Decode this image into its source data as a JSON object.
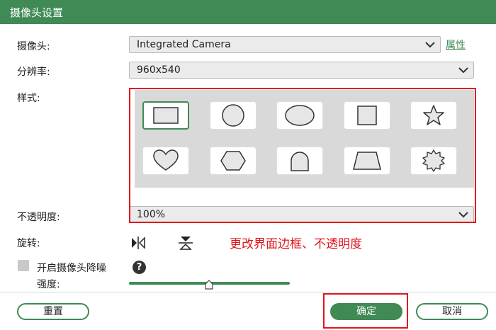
{
  "window": {
    "title": "摄像头设置"
  },
  "camera": {
    "label": "摄像头:",
    "value": "Integrated Camera",
    "properties_link": "属性"
  },
  "resolution": {
    "label": "分辨率:",
    "value": "960x540"
  },
  "style": {
    "label": "样式:",
    "shapes": [
      "rectangle",
      "circle",
      "ellipse",
      "square",
      "star",
      "heart",
      "hexagon",
      "arch",
      "trapezoid",
      "badge"
    ],
    "selected": "rectangle"
  },
  "opacity": {
    "label": "不透明度:",
    "value": "100%"
  },
  "rotate": {
    "label": "旋转:"
  },
  "denoise": {
    "label": "开启摄像头降噪",
    "checked": false,
    "help": "?"
  },
  "strength": {
    "label": "强度:",
    "level": 0.5
  },
  "annotation": {
    "text": "更改界面边框、不透明度"
  },
  "buttons": {
    "reset": "重置",
    "ok": "确定",
    "cancel": "取消"
  },
  "colors": {
    "accent": "#3f8a55",
    "highlight": "#e0141e"
  }
}
